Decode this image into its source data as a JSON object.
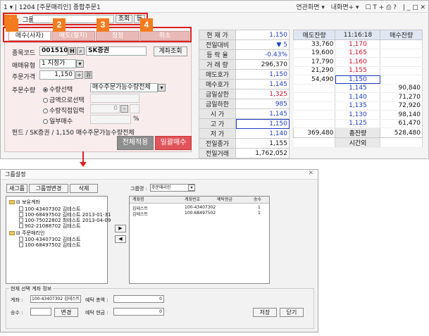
{
  "window": {
    "title": "1 ▾ | 1204 [주문매리인] 종합주문1",
    "right_menu": [
      "연관화면 ▾",
      "내화면+ ▾",
      "☐ T + ⎙ ?",
      "| _ □ ✕"
    ]
  },
  "top_controls": {
    "label": "그룹",
    "btn1": "조회",
    "btn2": "등"
  },
  "badges": [
    "1",
    "2",
    "3",
    "4"
  ],
  "tabs": [
    "매수(사자)",
    "매도(팔자)",
    "정정",
    "취소"
  ],
  "order_form": {
    "code_label": "종목코드",
    "code_value": "001510",
    "h_btn": "H",
    "name_value": "SK증권",
    "account_btn": "계좌조회",
    "type_label": "매매유형",
    "type_value": "1 지정가",
    "price_label": "주문가격",
    "price_value": "1,150",
    "won": "원",
    "qty_label": "주문수량",
    "radio1": "수량선택",
    "radio1_select": "매수주문가능수량전체",
    "radio2": "금액으로선택",
    "radio3": "수량직접입력",
    "radio3_value": "0",
    "radio4": "일부매수",
    "percent": "%",
    "fund_text": "펀드 / SK증권 / 1,150   매수주문가능수량전체",
    "apply_all_btn": "전체적용",
    "bulk_buy_btn": "일괄매수"
  },
  "quote": [
    {
      "label": "현 재 가",
      "value": "1,150",
      "color": "#1e3cc8"
    },
    {
      "label": "전일대비",
      "value": "▼          5",
      "color": "#1e3cc8"
    },
    {
      "label": "등 락 율",
      "value": "-0.43%",
      "color": "#1e3cc8"
    },
    {
      "label": "거 래 량",
      "value": "296,370",
      "color": "#111111"
    },
    {
      "label": "매도호가",
      "value": "1,150",
      "color": "#1e3cc8"
    },
    {
      "label": "매수호가",
      "value": "1,145",
      "color": "#1e3cc8"
    },
    {
      "label": "금일상한",
      "value": "1,325",
      "color": "#d4142a"
    },
    {
      "label": "금일하한",
      "value": "985",
      "color": "#1e3cc8"
    },
    {
      "label": "시   가",
      "value": "1,145",
      "color": "#1e3cc8"
    },
    {
      "label": "고   가",
      "value": "1,150",
      "color": "#1e3cc8"
    },
    {
      "label": "저   가",
      "value": "1,140",
      "color": "#1e3cc8"
    },
    {
      "label": "전일종가",
      "value": "1,155",
      "color": "#111111"
    },
    {
      "label": "전일거래",
      "value": "1,762,052",
      "color": "#111111"
    }
  ],
  "orderbook": {
    "header": [
      "매도잔량",
      "11:16:18",
      "매수잔량"
    ],
    "asks": [
      {
        "qty": "33,760",
        "price": "1,170"
      },
      {
        "qty": "19,600",
        "price": "1,165"
      },
      {
        "qty": "17,790",
        "price": "1,160"
      },
      {
        "qty": "21,290",
        "price": "1,155"
      },
      {
        "qty": "54,490",
        "price": "1,150"
      }
    ],
    "bids": [
      {
        "price": "1,145",
        "qty": "90,840"
      },
      {
        "price": "1,140",
        "qty": "71,270"
      },
      {
        "price": "1,135",
        "qty": "72,920"
      },
      {
        "price": "1,130",
        "qty": "98,140"
      },
      {
        "price": "1,125",
        "qty": "61,470"
      }
    ],
    "total_ask": "369,480",
    "total_label": "총잔량",
    "total_bid": "528,480",
    "after_hours": "시간외"
  },
  "dialog": {
    "title": "그룹설정",
    "btn_new": "새그룹",
    "btn_rename": "그룹명변경",
    "btn_delete": "삭제",
    "group_label": "그룹명 :",
    "group_value": "주문매리인",
    "tree": [
      "⊟ 보유계좌",
      "100-43407302 김테스트",
      "100-68497502 김테스트 2013-01-31",
      "100-75022802 최테스트 2013-04-09",
      "902-21088702 김테스트",
      "⊟ 주문매리인",
      "100-43407302 김테스트",
      "100-68497502 김테스트"
    ],
    "grid_headers": [
      "계좌명",
      "계좌번호",
      "예탁현금",
      "승수"
    ],
    "grid_rows": [
      [
        "김테스트",
        "100-43407302",
        "1"
      ],
      [
        "김테스트",
        "100-68497502",
        "1"
      ]
    ],
    "move_right": "▶",
    "move_left": "◀",
    "info_title": "현재 선택 계좌 정보",
    "acct_label": "계좌 :",
    "acct_value": "100-43407302 김테스트",
    "deposit_label": "예탁 총액 :",
    "deposit_value": "0",
    "mult_label": "승수 :",
    "change_btn": "변경",
    "cash_label": "예탁 현금 :",
    "cash_value": "0",
    "save_btn": "저장",
    "close_btn": "닫기"
  }
}
